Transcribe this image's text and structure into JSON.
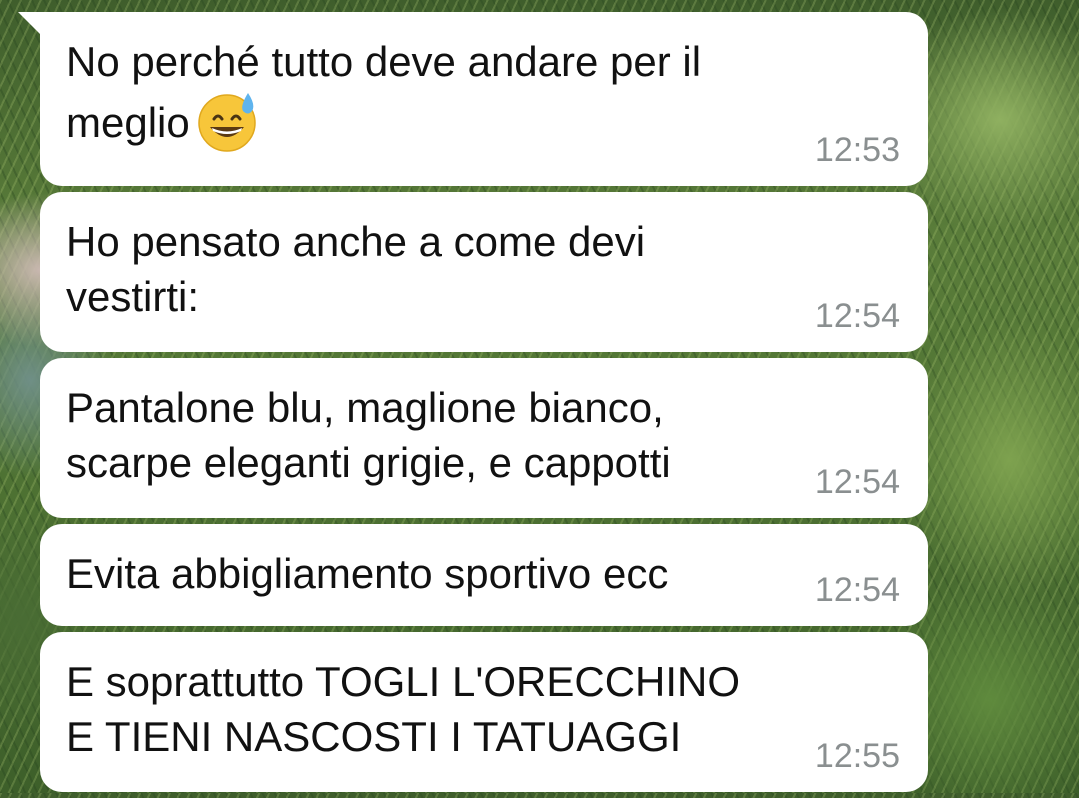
{
  "messages": [
    {
      "text": "No perché tutto deve andare per il meglio",
      "emoji": "grinning-sweat-emoji",
      "time": "12:53"
    },
    {
      "text": "Ho pensato anche a come devi vestirti:",
      "time": "12:54"
    },
    {
      "text": "Pantalone blu, maglione bianco, scarpe eleganti grigie, e cappotti",
      "time": "12:54"
    },
    {
      "text": "Evita abbigliamento sportivo ecc",
      "time": "12:54"
    },
    {
      "text": "E soprattutto TOGLI L'ORECCHINO E TIENI NASCOSTI I TATUAGGI",
      "time": "12:55"
    }
  ],
  "colors": {
    "bubble_bg": "#ffffff",
    "text": "#111111",
    "timestamp": "#8a8f90",
    "emoji_face": "#f7c63a",
    "sweat_drop": "#5fb4ee"
  }
}
